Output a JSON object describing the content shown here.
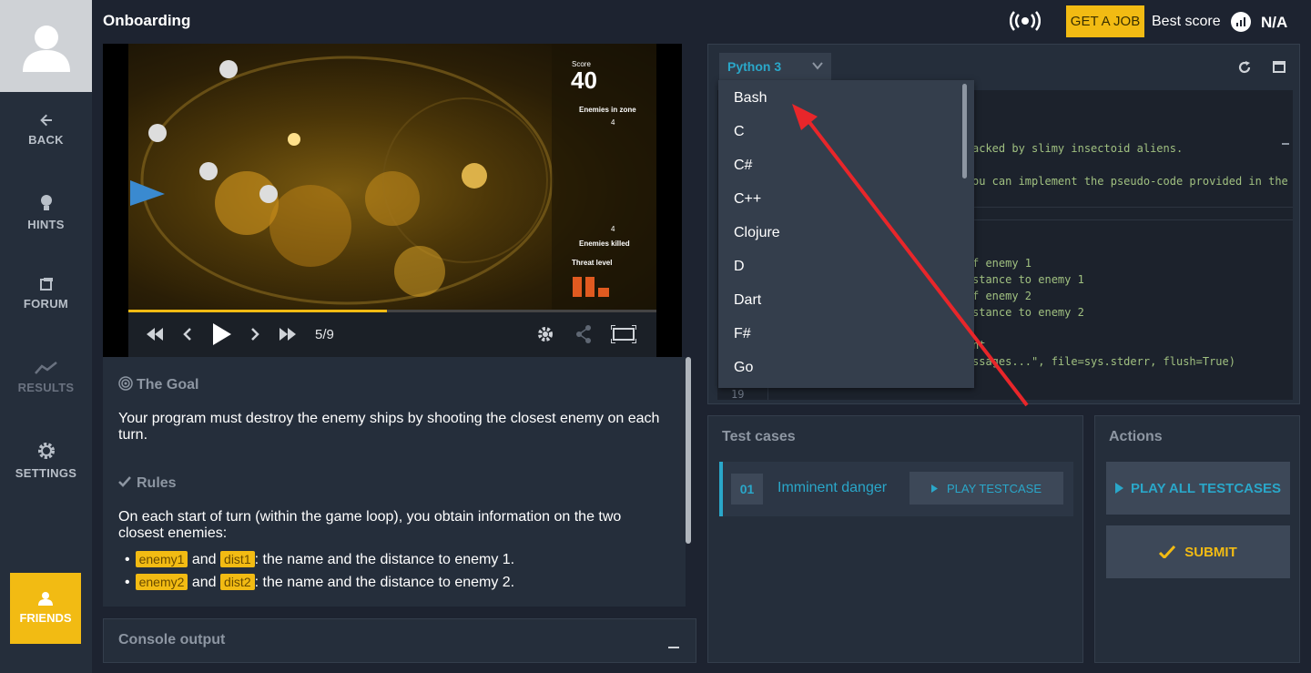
{
  "sidebar": {
    "items": [
      {
        "label": "BACK",
        "icon": "arrow-left-icon"
      },
      {
        "label": "HINTS",
        "icon": "lightbulb-icon"
      },
      {
        "label": "FORUM",
        "icon": "forum-icon"
      },
      {
        "label": "RESULTS",
        "icon": "chart-line-icon"
      },
      {
        "label": "SETTINGS",
        "icon": "gear-icon"
      }
    ],
    "friends_label": "FRIENDS"
  },
  "header": {
    "title": "Onboarding",
    "get_job_label": "GET A JOB",
    "best_score_label": "Best score",
    "best_score_value": "N/A"
  },
  "video": {
    "score_label": "Score",
    "score_value": "40",
    "enemies_in_zone_label": "Enemies in zone",
    "enemies_killed_label": "Enemies killed",
    "enemies_in_zone_value": "4",
    "enemies_killed_value": "4",
    "threat_label": "Threat level",
    "frame": "5/9",
    "progress": 0.49
  },
  "statement": {
    "goal_heading": "The Goal",
    "goal_text": "Your program must destroy the enemy ships by shooting the closest enemy on each turn.",
    "rules_heading": "Rules",
    "rules_text": "On each start of turn (within the game loop), you obtain information on the two closest enemies:",
    "bullets": [
      {
        "tag1": "enemy1",
        "and": "and",
        "tag2": "dist1",
        "text": ": the name and the distance to enemy 1."
      },
      {
        "tag1": "enemy2",
        "and": "and",
        "tag2": "dist2",
        "text": ": the name and the distance to enemy 2."
      }
    ]
  },
  "console": {
    "label": "Console output"
  },
  "editor": {
    "language": "Python 3",
    "code_lines": [
      "acked by slimy insectoid aliens.",
      "ou can implement the pseudo-code provided in the",
      "f enemy 1",
      "stance to enemy 1",
      "f enemy 2",
      "stance to enemy 2",
      "nt",
      "ssages...\", file=sys.stderr, flush=True)"
    ],
    "line_number": "19",
    "languages": [
      "Bash",
      "C",
      "C#",
      "C++",
      "Clojure",
      "D",
      "Dart",
      "F#",
      "Go"
    ]
  },
  "tests": {
    "heading": "Test cases",
    "items": [
      {
        "number": "01",
        "name": "Imminent danger",
        "play_label": "PLAY TESTCASE"
      }
    ]
  },
  "actions": {
    "heading": "Actions",
    "play_all_label": "PLAY ALL TESTCASES",
    "submit_label": "SUBMIT"
  },
  "colors": {
    "accent": "#f2bb13",
    "link": "#2aa7c9",
    "panel": "#252e3b",
    "annotation_arrow": "#e8262a"
  }
}
